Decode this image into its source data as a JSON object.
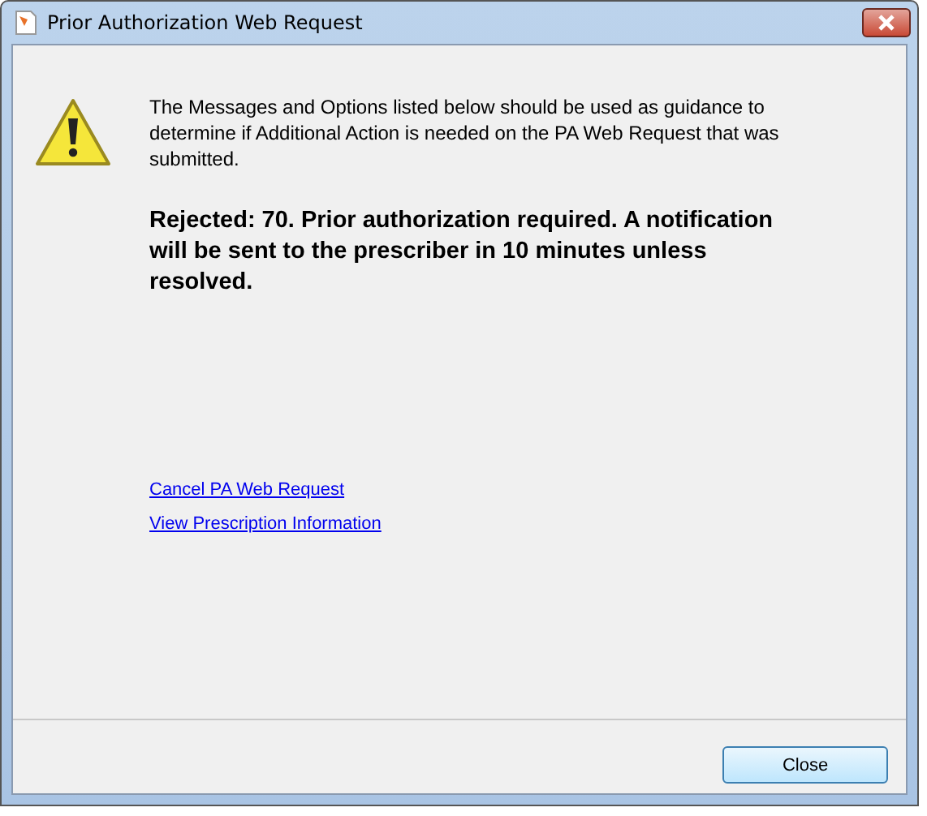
{
  "window": {
    "title": "Prior Authorization Web Request"
  },
  "message": {
    "intro": "The Messages and Options listed below should be used as guidance to determine if Additional Action is needed on the PA Web Request that was submitted.",
    "status": "Rejected: 70. Prior authorization required. A notification will be sent to the prescriber in 10 minutes unless resolved."
  },
  "links": [
    "Cancel PA Web Request",
    "View Prescription Information"
  ],
  "buttons": [
    "Close"
  ]
}
